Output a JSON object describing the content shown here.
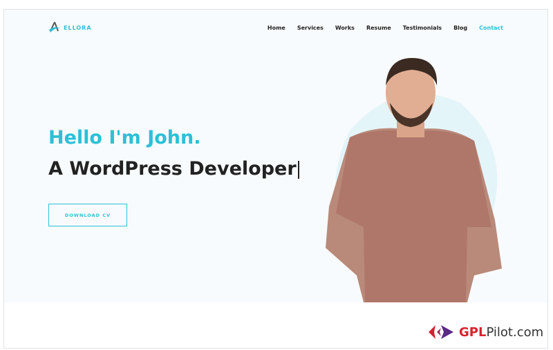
{
  "brand": {
    "name": "ELLORA",
    "accent": "#2cc0d8"
  },
  "nav": {
    "items": [
      {
        "label": "Home"
      },
      {
        "label": "Services"
      },
      {
        "label": "Works"
      },
      {
        "label": "Resume"
      },
      {
        "label": "Testimonials"
      },
      {
        "label": "Blog"
      },
      {
        "label": "Contact",
        "active": true
      }
    ]
  },
  "hero": {
    "greeting": "Hello I'm John.",
    "role": "A WordPress Developer",
    "button": "DOWNLOAD CV"
  },
  "watermark": {
    "bold": "GPL",
    "rest": "Pilot.com"
  }
}
